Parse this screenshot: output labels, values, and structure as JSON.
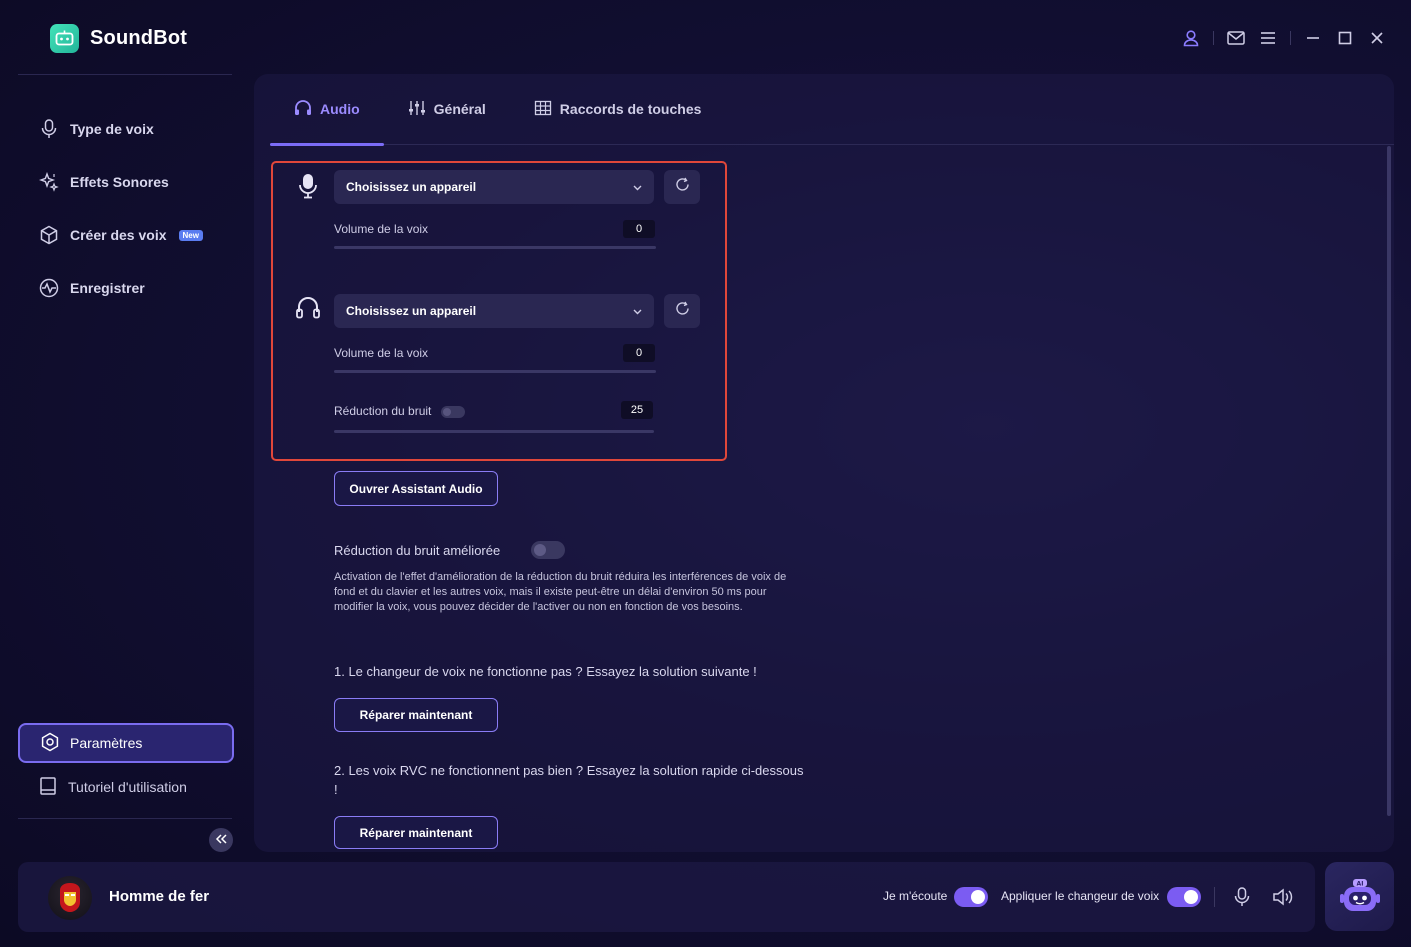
{
  "app": {
    "title": "SoundBot",
    "colors": {
      "accent": "#7b6cf6",
      "highlight_border": "#e0473a",
      "toggle_on": "#7b5cf2",
      "logo": "#34d1ad"
    }
  },
  "window_controls": [
    "user-icon",
    "mail-icon",
    "menu-icon",
    "minimize-icon",
    "maximize-icon",
    "close-icon"
  ],
  "sidebar": {
    "items": [
      {
        "label": "Type de voix",
        "icon": "microphone-icon"
      },
      {
        "label": "Effets Sonores",
        "icon": "sparkle-icon"
      },
      {
        "label": "Créer des voix",
        "icon": "cube-icon",
        "badge": "New"
      },
      {
        "label": "Enregistrer",
        "icon": "waveform-icon"
      }
    ],
    "settings_label": "Paramètres",
    "tutorial_label": "Tutoriel d'utilisation"
  },
  "tabs": [
    {
      "label": "Audio",
      "icon": "headphones-icon",
      "active": true
    },
    {
      "label": "Général",
      "icon": "sliders-icon",
      "active": false
    },
    {
      "label": "Raccords de touches",
      "icon": "grid-icon",
      "active": false
    }
  ],
  "audio": {
    "input": {
      "device_placeholder": "Choisissez un appareil",
      "volume_label": "Volume de la voix",
      "volume_value": "0"
    },
    "output": {
      "device_placeholder": "Choisissez un appareil",
      "volume_label": "Volume de la voix",
      "volume_value": "0",
      "noise_label": "Réduction du bruit",
      "noise_value": "25"
    },
    "assistant_button": "Ouvrer Assistant Audio",
    "enhanced_noise_label": "Réduction du bruit améliorée",
    "enhanced_noise_desc": "Activation de l'effet d'amélioration de la réduction du bruit réduira les interférences de voix de fond et du clavier et les autres voix, mais il existe peut-être un délai d'environ 50 ms pour modifier la voix, vous pouvez décider de l'activer ou non en fonction de vos besoins.",
    "fix1_text": "1. Le changeur de voix ne fonctionne pas ? Essayez la solution suivante !",
    "fix1_button": "Réparer maintenant",
    "fix2_text": "2. Les voix RVC ne fonctionnent pas bien ? Essayez la solution rapide ci-dessous !",
    "fix2_button": "Réparer maintenant"
  },
  "bottom_bar": {
    "voice_name": "Homme de fer",
    "listen_label": "Je m'écoute",
    "apply_label": "Appliquer le changeur de voix",
    "ai_badge": "AI"
  }
}
